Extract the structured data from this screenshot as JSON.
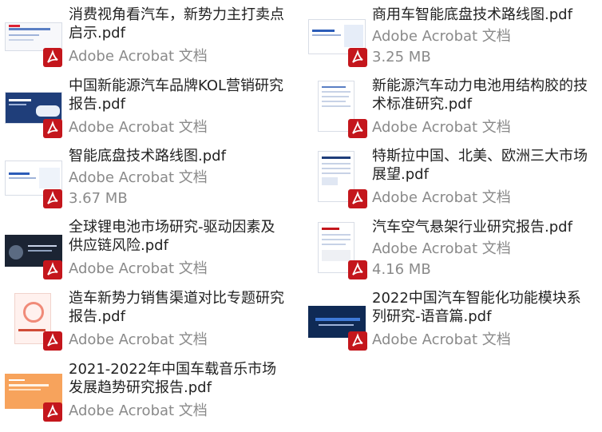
{
  "files": [
    {
      "title": "消费视角看汽车，新势力主打卖点启示.pdf",
      "type": "Adobe Acrobat 文档",
      "size": "",
      "icon": "pdf-icon"
    },
    {
      "title": "商用车智能底盘技术路线图.pdf",
      "type": "Adobe Acrobat 文档",
      "size": "3.25 MB",
      "icon": "pdf-icon"
    },
    {
      "title": "中国新能源汽车品牌KOL营销研究报告.pdf",
      "type": "Adobe Acrobat 文档",
      "size": "",
      "icon": "pdf-icon"
    },
    {
      "title": "新能源汽车动力电池用结构胶的技术标准研究.pdf",
      "type": "Adobe Acrobat 文档",
      "size": "",
      "icon": "pdf-icon"
    },
    {
      "title": "智能底盘技术路线图.pdf",
      "type": "Adobe Acrobat 文档",
      "size": "3.67 MB",
      "icon": "pdf-icon"
    },
    {
      "title": "特斯拉中国、北美、欧洲三大市场展望.pdf",
      "type": "Adobe Acrobat 文档",
      "size": "",
      "icon": "pdf-icon"
    },
    {
      "title": "全球锂电池市场研究-驱动因素及供应链风险.pdf",
      "type": "Adobe Acrobat 文档",
      "size": "",
      "icon": "pdf-icon"
    },
    {
      "title": "汽车空气悬架行业研究报告.pdf",
      "type": "Adobe Acrobat 文档",
      "size": "4.16 MB",
      "icon": "pdf-icon"
    },
    {
      "title": "造车新势力销售渠道对比专题研究报告.pdf",
      "type": "Adobe Acrobat 文档",
      "size": "",
      "icon": "pdf-icon"
    },
    {
      "title": "2022中国汽车智能化功能模块系列研究-语音篇.pdf",
      "type": "Adobe Acrobat 文档",
      "size": "",
      "icon": "pdf-icon"
    },
    {
      "title": "2021-2022年中国车载音乐市场发展趋势研究报告.pdf",
      "type": "Adobe Acrobat 文档",
      "size": "",
      "icon": "pdf-icon"
    }
  ],
  "colors": {
    "pdf_red": "#c4161c",
    "title_text": "#222222",
    "meta_text": "#8a8a8a"
  }
}
